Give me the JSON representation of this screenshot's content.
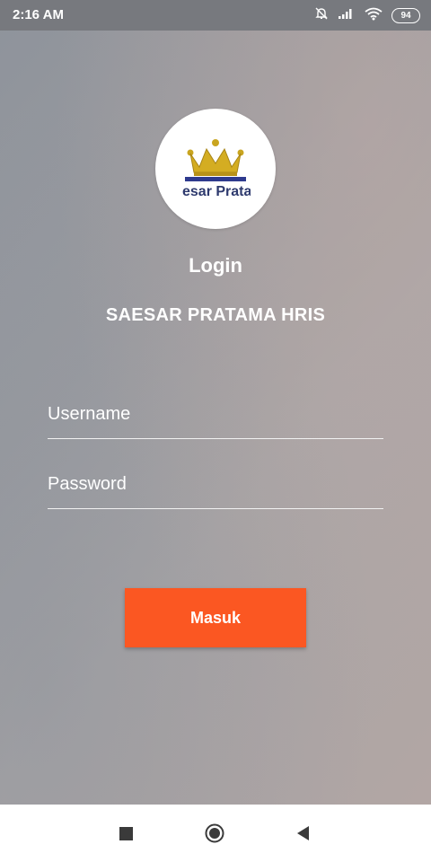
{
  "status_bar": {
    "time": "2:16 AM",
    "battery_level": "94",
    "icons": [
      "mute-icon",
      "signal-icon",
      "wifi-icon",
      "battery-icon"
    ]
  },
  "logo": {
    "text": "esar Pratai",
    "icon": "crown-icon"
  },
  "login": {
    "title": "Login",
    "app_name": "SAESAR PRATAMA HRIS",
    "username_placeholder": "Username",
    "username_value": "",
    "password_placeholder": "Password",
    "password_value": "",
    "submit_label": "Masuk"
  },
  "navigation": {
    "icons": [
      "recents-icon",
      "home-icon",
      "back-icon"
    ]
  },
  "colors": {
    "accent": "#fb5722",
    "status_bar": "#77797e",
    "logo_text": "#2e3a6e",
    "crown_gold": "#c9a520"
  }
}
